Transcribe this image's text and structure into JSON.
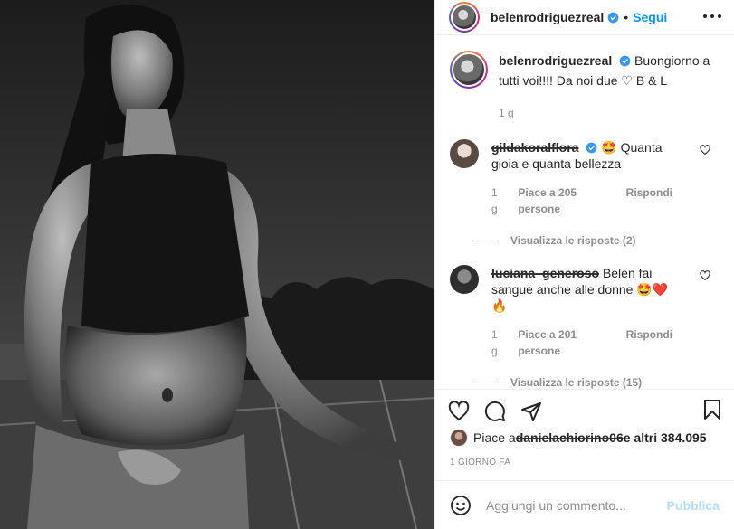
{
  "header": {
    "username": "belenrodriguezreal",
    "follow_label": "Segui"
  },
  "caption": {
    "username": "belenrodriguezreal",
    "text": "Buongiorno a tutti voi!!!! Da noi due ♡ B & L",
    "time": "1 g"
  },
  "comments": [
    {
      "username": "gildakoralflora",
      "text": "🤩 Quanta gioia e quanta bellezza",
      "time": "1 g",
      "likes": "Piace a 205 persone",
      "reply": "Rispondi",
      "view_replies": "Visualizza le risposte (2)"
    },
    {
      "username": "luciana_generoso",
      "text": "Belen fai sangue anche alle donne 🤩❤️ 🔥",
      "time": "1 g",
      "likes": "Piace a 201 persone",
      "reply": "Rispondi",
      "view_replies": "Visualizza le risposte (15)"
    }
  ],
  "likes": {
    "prefix": "Piace a ",
    "user": "danielachiorino06",
    "suffix": " e altri 384.095"
  },
  "posted_ago": "1 GIORNO FA",
  "add_comment": {
    "placeholder": "Aggiungi un commento...",
    "publish_label": "Pubblica"
  },
  "colors": {
    "accent": "#0095f6",
    "muted": "#8e8e8e",
    "text": "#262626",
    "publish_disabled": "#b2dffc"
  }
}
